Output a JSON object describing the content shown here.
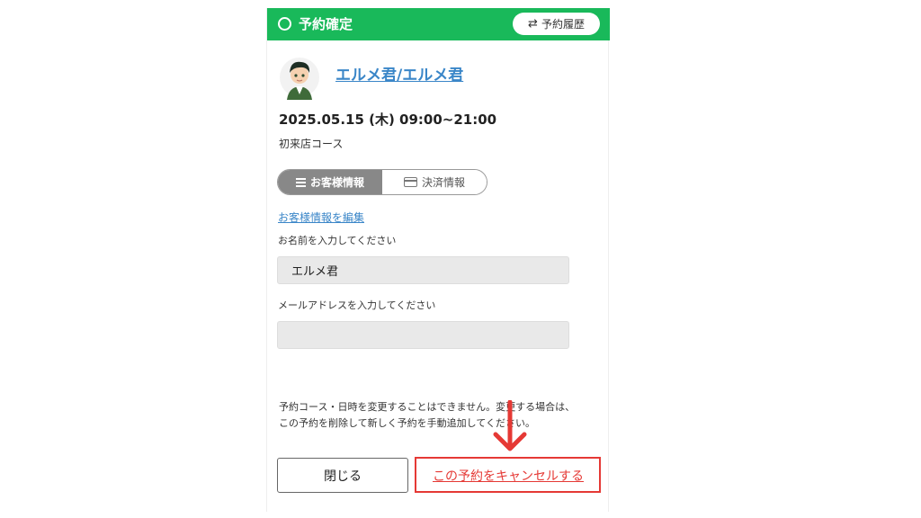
{
  "header": {
    "title": "予約確定",
    "history_label": "予約履歴",
    "history_icon": "swap-arrows-icon",
    "color": "#19b95a"
  },
  "reservation": {
    "user_name": "エルメ君/エルメ君",
    "datetime": "2025.05.15 (木) 09:00~21:00",
    "course": "初来店コース"
  },
  "tabs": [
    {
      "label": "お客様情報",
      "icon": "list-icon",
      "active": true
    },
    {
      "label": "決済情報",
      "icon": "credit-card-icon",
      "active": false
    }
  ],
  "form": {
    "edit_link": "お客様情報を編集",
    "name_label": "お名前を入力してください",
    "name_value": "エルメ君",
    "email_label": "メールアドレスを入力してください",
    "email_value": ""
  },
  "notice": {
    "line1": "予約コース・日時を変更することはできません。変更する場合は、",
    "line2": "この予約を削除して新しく予約を手動追加してください。"
  },
  "footer": {
    "close_label": "閉じる",
    "cancel_label": "この予約をキャンセルする",
    "accent_color": "#e53935"
  }
}
